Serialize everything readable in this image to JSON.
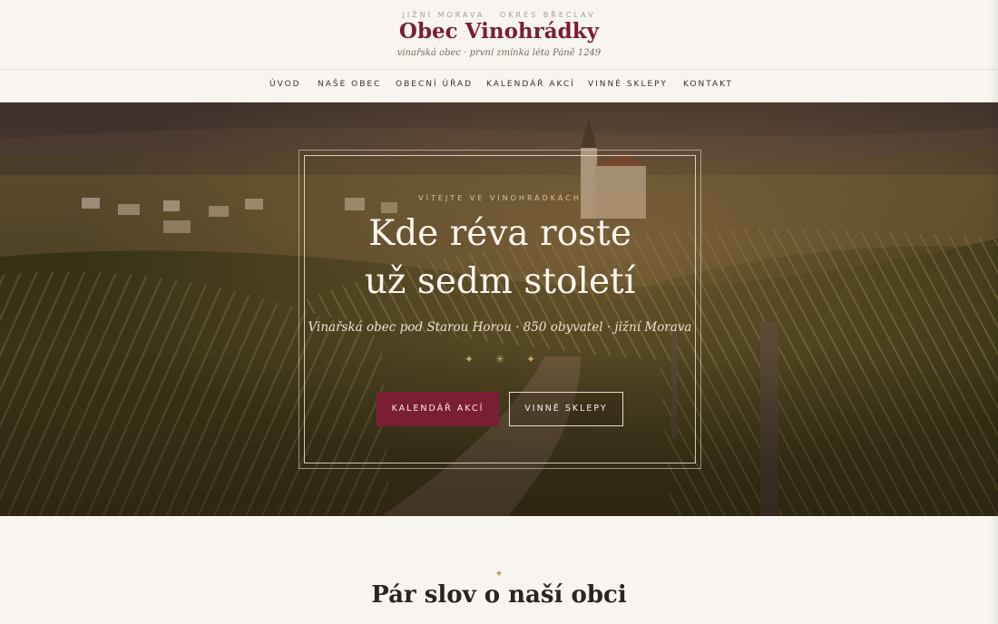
{
  "header": {
    "region": "JIŽNÍ MORAVA · OKRES BŘECLAV",
    "title": "Obec Vinohrádky",
    "tagline": "vinařská obec · první zmínka léta Páně 1249"
  },
  "nav": {
    "items": [
      {
        "label": "ÚVOD",
        "active": true
      },
      {
        "label": "NAŠE OBEC"
      },
      {
        "label": "OBECNÍ ÚŘAD"
      },
      {
        "label": "KALENDÁŘ AKCÍ"
      },
      {
        "label": "VINNÉ SKLEPY"
      },
      {
        "label": "KONTAKT"
      }
    ]
  },
  "hero": {
    "kicker": "VÍTEJTE VE VINOHRÁDKÁCH",
    "headline_line1": "Kde réva roste",
    "headline_line2": "už sedm století",
    "subline": "Vinařská obec pod Starou Horou · 850 obyvatel · jižní Morava",
    "ornament": "✦✳✦",
    "primary_button": "KALENDÁŘ AKCÍ",
    "secondary_button": "VINNÉ SKLEPY"
  },
  "section": {
    "ornament": "✦",
    "title": "Pár slov o naší obci"
  },
  "colors": {
    "accent": "#7a1e33",
    "gold": "#b8925a",
    "background": "#f8f5f0"
  }
}
